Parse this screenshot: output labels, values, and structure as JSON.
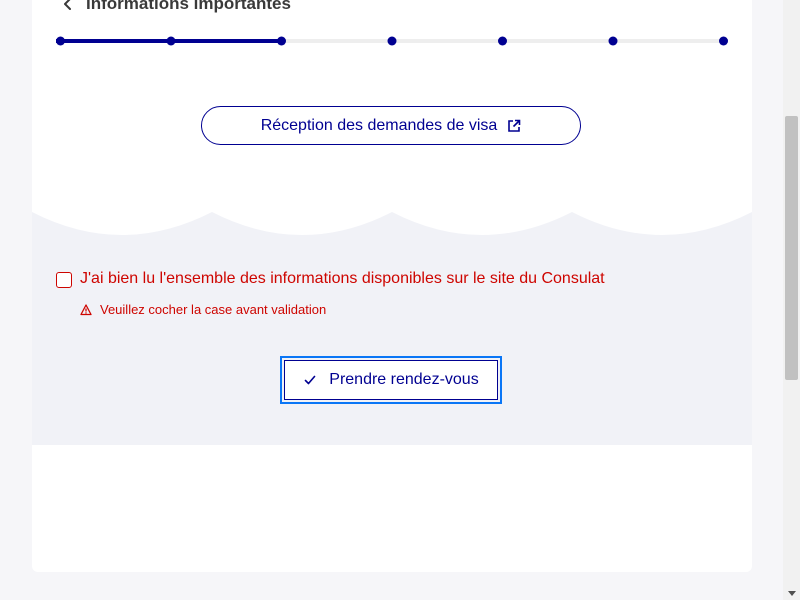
{
  "header": {
    "back_title": "Informations importantes"
  },
  "stepper": {
    "total_steps": 7,
    "completed_steps": 3,
    "active_color": "#000091",
    "inactive_color": "#eeeeee"
  },
  "links": {
    "visa_label": "Réception des demandes de visa"
  },
  "consent": {
    "checkbox_label": "J'ai bien lu l'ensemble des informations disponibles sur le site du Consulat",
    "error_message": "Veuillez cocher la case avant validation"
  },
  "actions": {
    "submit_label": "Prendre rendez-vous"
  },
  "colors": {
    "brand_blue": "#000091",
    "error_red": "#ce0500",
    "focus_blue": "#0a76f6",
    "section_bg": "#f1f2f7"
  }
}
